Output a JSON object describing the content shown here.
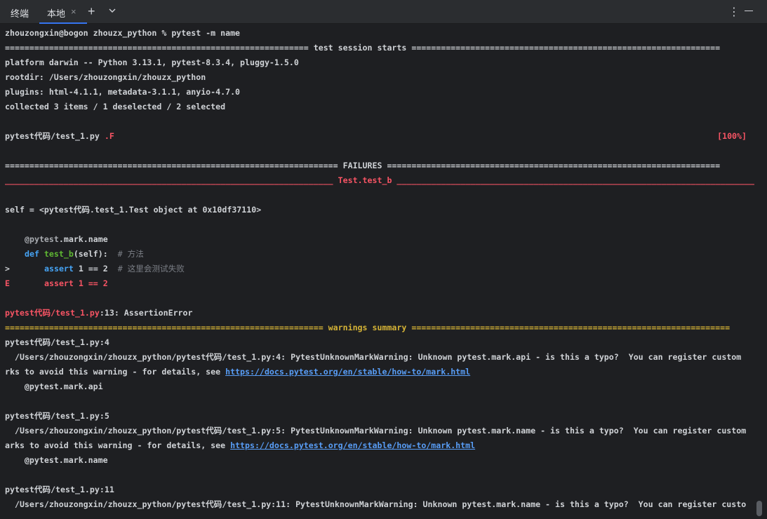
{
  "tabbar": {
    "title": "终端",
    "tab_label": "本地",
    "close_glyph": "×",
    "add_glyph": "+",
    "chevron_glyph": "⌵",
    "more_glyph": "⋮"
  },
  "terminal": {
    "line_01": "zhouzongxin@bogon zhouzx_python % pytest -m name",
    "line_02": "============================================================== test session starts ===============================================================",
    "line_03": "platform darwin -- Python 3.13.1, pytest-8.3.4, pluggy-1.5.0",
    "line_04": "rootdir: /Users/zhouzongxin/zhouzx_python",
    "line_05": "plugins: html-4.1.1, metadata-3.1.1, anyio-4.7.0",
    "line_06": "collected 3 items / 1 deselected / 2 selected",
    "line_08_file": "pytest代码/test_1.py ",
    "line_08_result": ".F",
    "line_08_pct": "[100%]",
    "line_10": "==================================================================== FAILURES ====================================================================",
    "line_11_left": "___________________________________________________________________ ",
    "line_11_mid": "Test.test_b",
    "line_11_right": " _________________________________________________________________________",
    "line_13": "self = <pytest代码.test_1.Test object at 0x10df37110>",
    "line_15_deco": "@pytest",
    "line_15_rest": ".mark.name",
    "line_16_def": "def ",
    "line_16_fn": "test_b",
    "line_16_sig": "(self):",
    "line_16_comment": "  # 方法",
    "line_17_prefix": ">",
    "line_17_assert": "assert ",
    "line_17_expr": "1 == 2",
    "line_17_comment": "  # 这里会测试失败",
    "line_18_prefix": "E",
    "line_18_code": "assert 1 == 2",
    "line_20_path": "pytest代码/test_1.py",
    "line_20_rest": ":13: AssertionError",
    "line_21": "================================================================= warnings summary =================================================================",
    "line_22": "pytest代码/test_1.py:4",
    "line_23": "  /Users/zhouzongxin/zhouzx_python/pytest代码/test_1.py:4: PytestUnknownMarkWarning: Unknown pytest.mark.api - is this a typo?  You can register custom",
    "line_24_text": "rks to avoid this warning - for details, see ",
    "line_24_link": "https://docs.pytest.org/en/stable/how-to/mark.html",
    "line_25": "    @pytest.mark.api",
    "line_27": "pytest代码/test_1.py:5",
    "line_28": "  /Users/zhouzongxin/zhouzx_python/pytest代码/test_1.py:5: PytestUnknownMarkWarning: Unknown pytest.mark.name - is this a typo?  You can register custom",
    "line_29_text": "arks to avoid this warning - for details, see ",
    "line_29_link": "https://docs.pytest.org/en/stable/how-to/mark.html",
    "line_30": "    @pytest.mark.name",
    "line_32": "pytest代码/test_1.py:11",
    "line_33": "  /Users/zhouzongxin/zhouzx_python/pytest代码/test_1.py:11: PytestUnknownMarkWarning: Unknown pytest.mark.name - is this a typo?  You can register custo"
  },
  "colors": {
    "background": "#1e1f22",
    "error": "#f75464",
    "warning": "#d5b336",
    "keyword": "#46a4f5",
    "function": "#5fb832",
    "link": "#589df6",
    "tab_accent": "#3574f0"
  }
}
